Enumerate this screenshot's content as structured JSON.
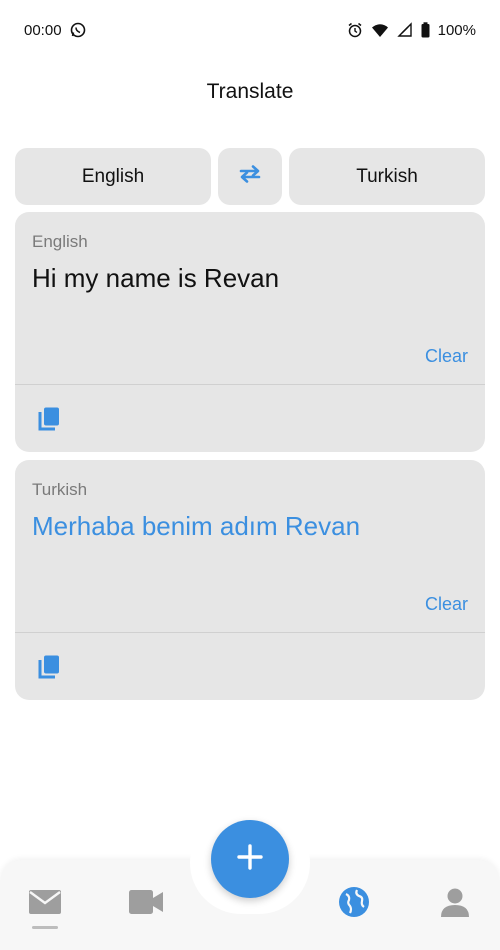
{
  "status_bar": {
    "time": "00:00",
    "battery": "100%",
    "icons": [
      "whatsapp-icon",
      "alarm-icon",
      "wifi-icon",
      "signal-icon",
      "battery-icon"
    ]
  },
  "header": {
    "title": "Translate"
  },
  "language_selector": {
    "source": "English",
    "target": "Turkish",
    "swap_icon": "swap-arrows-icon"
  },
  "source_card": {
    "language": "English",
    "text": "Hi my name is Revan",
    "clear_label": "Clear",
    "copy_icon": "copy-icon"
  },
  "target_card": {
    "language": "Turkish",
    "text": "Merhaba benim adım Revan",
    "clear_label": "Clear",
    "copy_icon": "copy-icon"
  },
  "bottom_nav": {
    "items": [
      {
        "icon": "mail-icon",
        "active": false
      },
      {
        "icon": "video-icon",
        "active": false
      },
      {
        "icon": "globe-icon",
        "active": true
      },
      {
        "icon": "profile-icon",
        "active": false
      }
    ],
    "fab_icon": "plus-icon"
  },
  "colors": {
    "accent": "#3b8fe0",
    "card_background": "#e6e6e6",
    "inactive_icon": "#9e9e9e"
  }
}
